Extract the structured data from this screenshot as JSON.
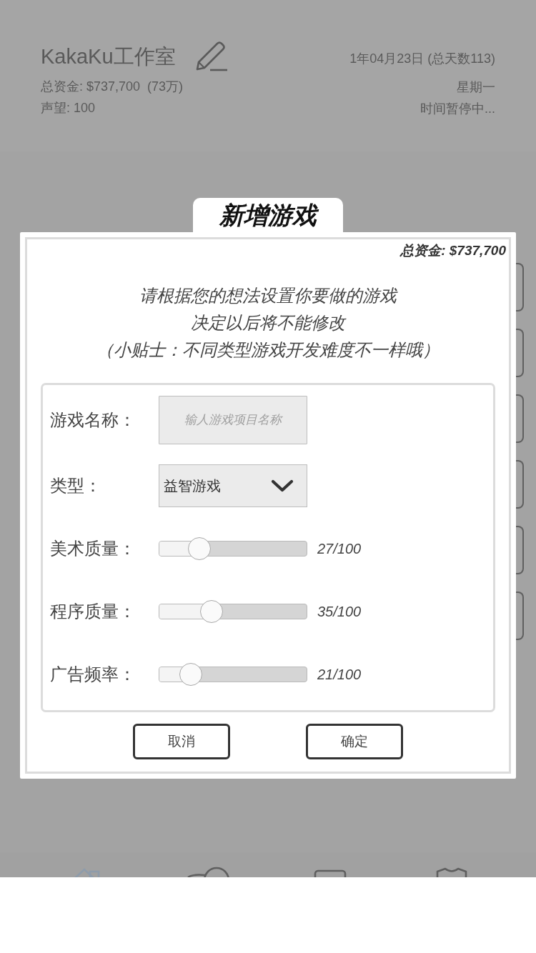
{
  "header": {
    "studio_name": "KakaKu工作室",
    "funds": "总资金: $737,700  (73万)",
    "reputation": "声望: 100",
    "date": "1年04月23日 (总天数113)",
    "weekday": "星期一",
    "time_status": "时间暂停中..."
  },
  "dialog": {
    "title": "新增游戏",
    "funds": "总资金: $737,700",
    "intro": [
      "请根据您的想法设置你要做的游戏",
      "决定以后将不能修改",
      "（小贴士：不同类型游戏开发难度不一样哦）"
    ],
    "fields": [
      {
        "kind": "text",
        "label": "游戏名称：",
        "placeholder": "输人游戏项目名称"
      },
      {
        "kind": "select",
        "label": "类型：",
        "value": "益智游戏"
      },
      {
        "kind": "slider",
        "label": "美术质量：",
        "level": 0.27,
        "reading": "27/100"
      },
      {
        "kind": "slider",
        "label": "程序质量：",
        "level": 0.35,
        "reading": "35/100"
      },
      {
        "kind": "slider",
        "label": "广告频率：",
        "level": 0.21,
        "reading": "21/100"
      }
    ],
    "buttons": [
      {
        "label": "取消"
      },
      {
        "label": "确定"
      }
    ]
  },
  "nav_tabs": [
    {
      "selected": true
    },
    {
      "selected": false
    },
    {
      "selected": false
    },
    {
      "selected": false
    }
  ]
}
